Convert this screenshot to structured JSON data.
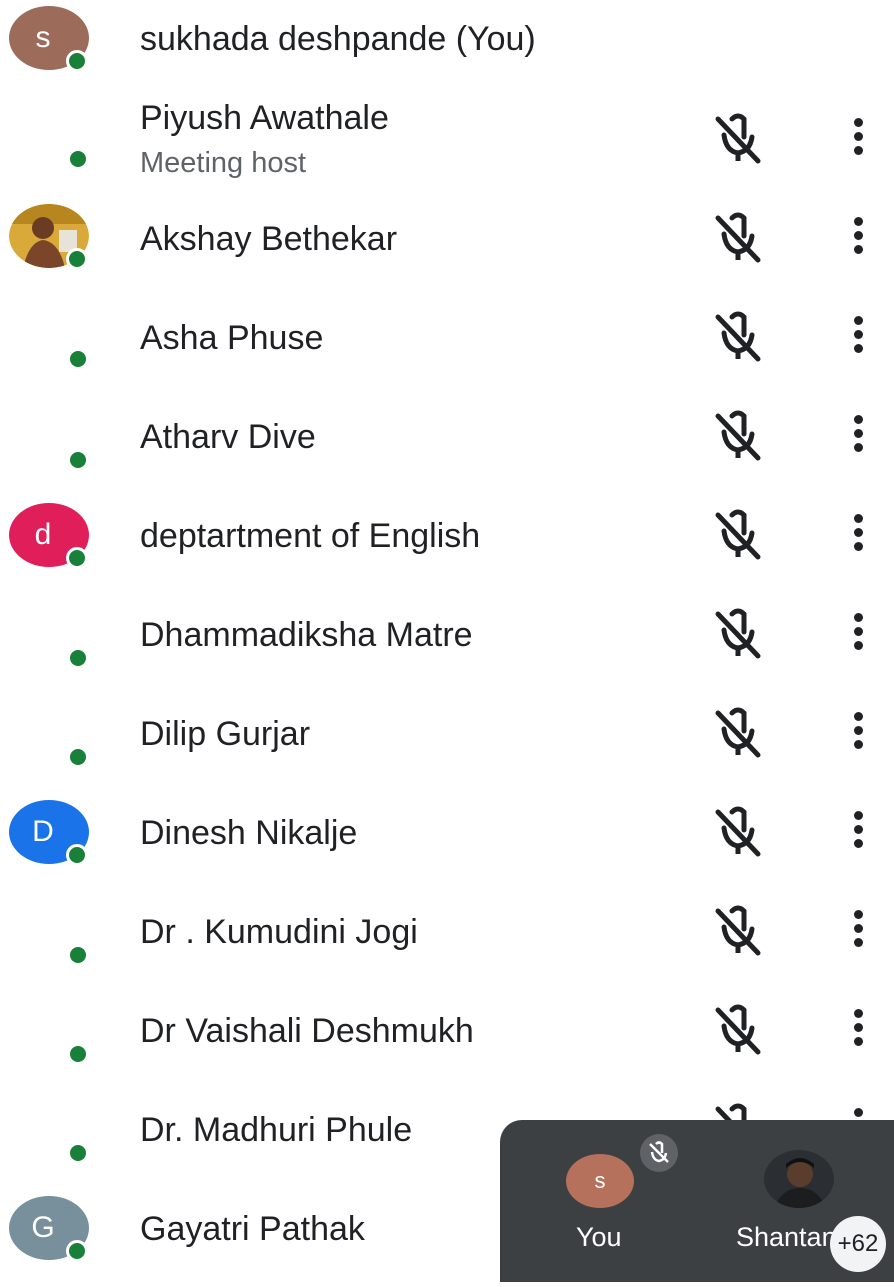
{
  "participants": [
    {
      "name": "sukhada deshpande (You)",
      "initial": "s",
      "avatar_color": "#9c6b5a",
      "sub": "",
      "controls": false
    },
    {
      "name": "Piyush Awathale",
      "initial": "",
      "avatar_color": "",
      "sub": "Meeting host",
      "controls": true
    },
    {
      "name": "Akshay Bethekar",
      "initial": "",
      "avatar_color": "photo",
      "sub": "",
      "controls": true
    },
    {
      "name": "Asha Phuse",
      "initial": "",
      "avatar_color": "",
      "sub": "",
      "controls": true
    },
    {
      "name": "Atharv Dive",
      "initial": "",
      "avatar_color": "",
      "sub": "",
      "controls": true
    },
    {
      "name": "deptartment of English",
      "initial": "d",
      "avatar_color": "#e01e5a",
      "sub": "",
      "controls": true
    },
    {
      "name": "Dhammadiksha Matre",
      "initial": "",
      "avatar_color": "",
      "sub": "",
      "controls": true
    },
    {
      "name": "Dilip Gurjar",
      "initial": "",
      "avatar_color": "",
      "sub": "",
      "controls": true
    },
    {
      "name": "Dinesh Nikalje",
      "initial": "D",
      "avatar_color": "#1a73e8",
      "sub": "",
      "controls": true
    },
    {
      "name": "Dr . Kumudini Jogi",
      "initial": "",
      "avatar_color": "",
      "sub": "",
      "controls": true
    },
    {
      "name": "Dr Vaishali Deshmukh",
      "initial": "",
      "avatar_color": "",
      "sub": "",
      "controls": true
    },
    {
      "name": "Dr. Madhuri Phule",
      "initial": "",
      "avatar_color": "",
      "sub": "",
      "controls": true
    },
    {
      "name": "Gayatri Pathak",
      "initial": "G",
      "avatar_color": "#78909c",
      "sub": "",
      "controls": false
    }
  ],
  "icons": {
    "mic": "mic-off-icon",
    "more": "more-vert-icon",
    "status": "online-status-dot"
  },
  "colors": {
    "online": "#188038",
    "pip_background": "#3c4043"
  },
  "pip": {
    "self_initial": "s",
    "self_label": "You",
    "other_label": "Shantanu",
    "more_count": "+62"
  }
}
